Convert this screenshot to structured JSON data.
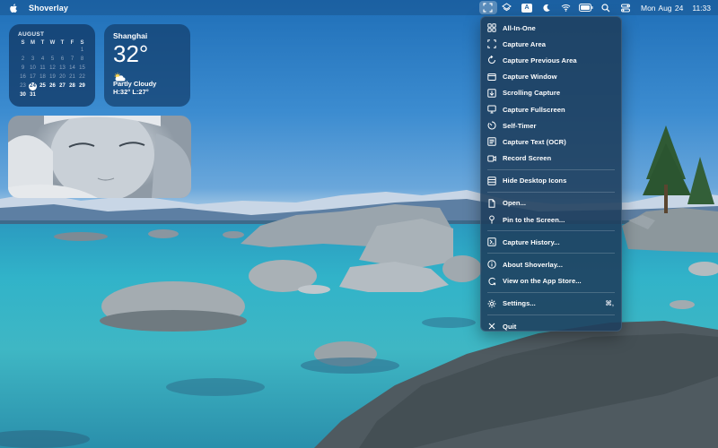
{
  "menubar": {
    "app_name": "Shoverlay",
    "date": "Mon Aug 24",
    "time": "11:33",
    "input_source": "A"
  },
  "calendar": {
    "month": "AUGUST",
    "weekdays": [
      "S",
      "M",
      "T",
      "W",
      "T",
      "F",
      "S"
    ],
    "weeks": [
      [
        "",
        "",
        "",
        "",
        "",
        "",
        "1"
      ],
      [
        "2",
        "3",
        "4",
        "5",
        "6",
        "7",
        "8"
      ],
      [
        "9",
        "10",
        "11",
        "12",
        "13",
        "14",
        "15"
      ],
      [
        "16",
        "17",
        "18",
        "19",
        "20",
        "21",
        "22"
      ],
      [
        "23",
        "24",
        "25",
        "26",
        "27",
        "28",
        "29"
      ],
      [
        "30",
        "31",
        "",
        "",
        "",
        "",
        ""
      ]
    ],
    "today": "24"
  },
  "weather": {
    "city": "Shanghai",
    "temperature": "32°",
    "condition": "Partly Cloudy",
    "range": "H:32° L:27°",
    "icon": "partly-cloudy-icon"
  },
  "menu": {
    "groups": [
      [
        {
          "label": "All-In-One",
          "icon": "grid-icon"
        },
        {
          "label": "Capture Area",
          "icon": "area-icon"
        },
        {
          "label": "Capture Previous Area",
          "icon": "previous-area-icon"
        },
        {
          "label": "Capture Window",
          "icon": "window-icon"
        },
        {
          "label": "Scrolling Capture",
          "icon": "scroll-icon"
        },
        {
          "label": "Capture Fullscreen",
          "icon": "monitor-icon"
        },
        {
          "label": "Self-Timer",
          "icon": "timer-icon"
        },
        {
          "label": "Capture Text (OCR)",
          "icon": "text-icon"
        },
        {
          "label": "Record Screen",
          "icon": "record-icon"
        }
      ],
      [
        {
          "label": "Hide Desktop Icons",
          "icon": "hide-icon"
        }
      ],
      [
        {
          "label": "Open...",
          "icon": "open-icon"
        },
        {
          "label": "Pin to the Screen...",
          "icon": "pin-icon"
        }
      ],
      [
        {
          "label": "Capture History...",
          "icon": "history-icon"
        }
      ],
      [
        {
          "label": "About Shoverlay...",
          "icon": "info-icon"
        },
        {
          "label": "View on the App Store...",
          "icon": "appstore-icon"
        }
      ],
      [
        {
          "label": "Settings...",
          "icon": "gear-icon",
          "shortcut": "⌘,"
        }
      ],
      [
        {
          "label": "Quit",
          "icon": "close-icon"
        }
      ]
    ]
  }
}
